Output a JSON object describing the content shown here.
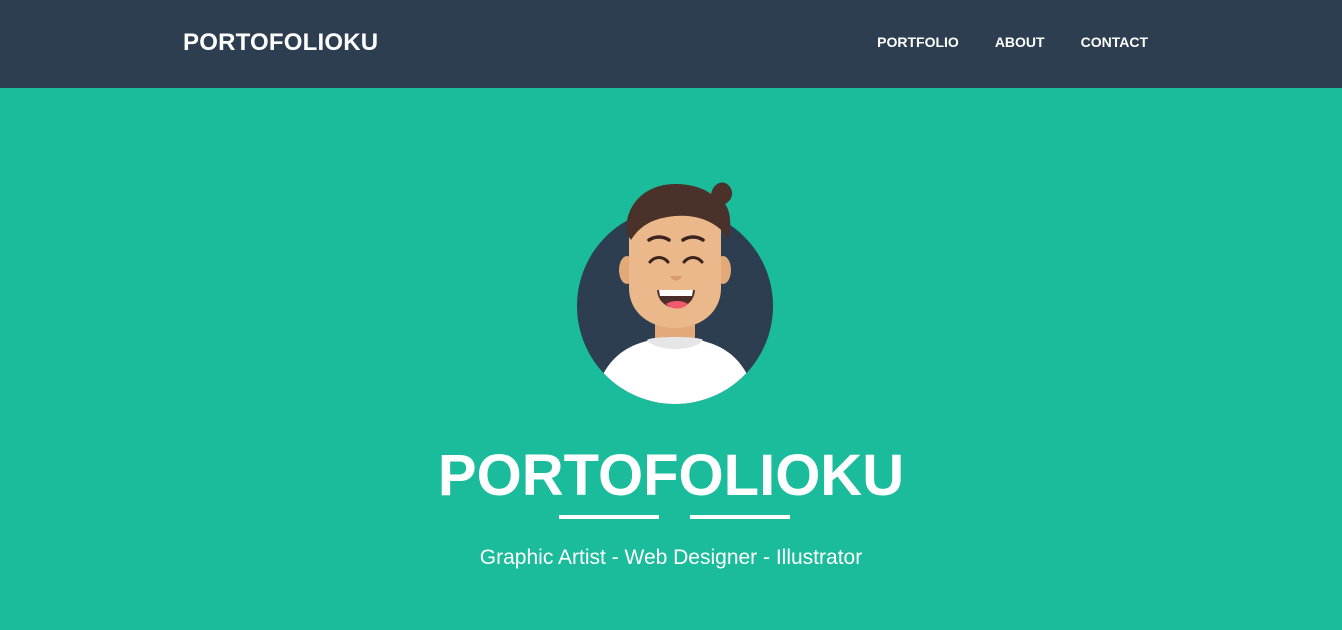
{
  "navbar": {
    "brand": "PORTOFOLIOKU",
    "links": [
      "PORTFOLIO",
      "ABOUT",
      "CONTACT"
    ]
  },
  "hero": {
    "title": "PORTOFOLIOKU",
    "subtitle": "Graphic Artist - Web Designer - Illustrator",
    "avatar_icon": "avatar-icon"
  },
  "colors": {
    "navbar_bg": "#2c3e50",
    "hero_bg": "#1abc9c",
    "text": "#ffffff",
    "avatar_circle": "#2c3e50",
    "hair": "#4a3129",
    "skin": "#eab88a",
    "shirt": "#ffffff"
  }
}
